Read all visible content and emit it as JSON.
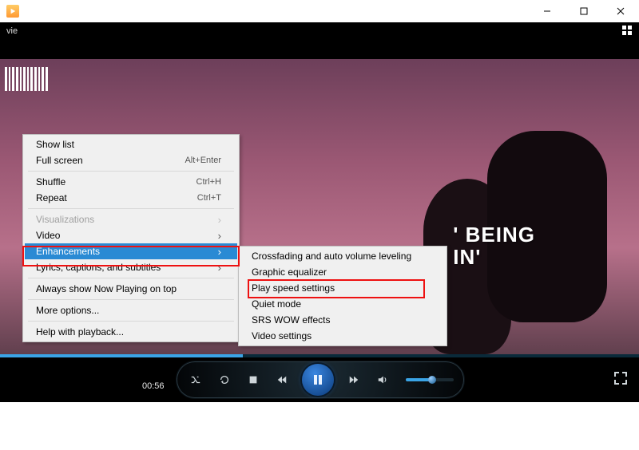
{
  "window": {
    "title": ""
  },
  "toolbar": {
    "left_text": "vie"
  },
  "caption": {
    "line1": "' BEING",
    "line2": "IN'"
  },
  "context_menu": {
    "show_list": "Show list",
    "full_screen": {
      "label": "Full screen",
      "shortcut": "Alt+Enter"
    },
    "shuffle": {
      "label": "Shuffle",
      "shortcut": "Ctrl+H"
    },
    "repeat": {
      "label": "Repeat",
      "shortcut": "Ctrl+T"
    },
    "visualizations": "Visualizations",
    "video": "Video",
    "enhancements": "Enhancements",
    "lyrics": "Lyrics, captions, and subtitles",
    "always_on_top": "Always show Now Playing on top",
    "more_options": "More options...",
    "help": "Help with playback..."
  },
  "enhancements_submenu": {
    "crossfading": "Crossfading and auto volume leveling",
    "graphic_eq": "Graphic equalizer",
    "play_speed": "Play speed settings",
    "quiet_mode": "Quiet mode",
    "srs_wow": "SRS WOW effects",
    "video_settings": "Video settings"
  },
  "playback": {
    "time": "00:56",
    "progress_pct": 38,
    "volume_pct": 55
  }
}
